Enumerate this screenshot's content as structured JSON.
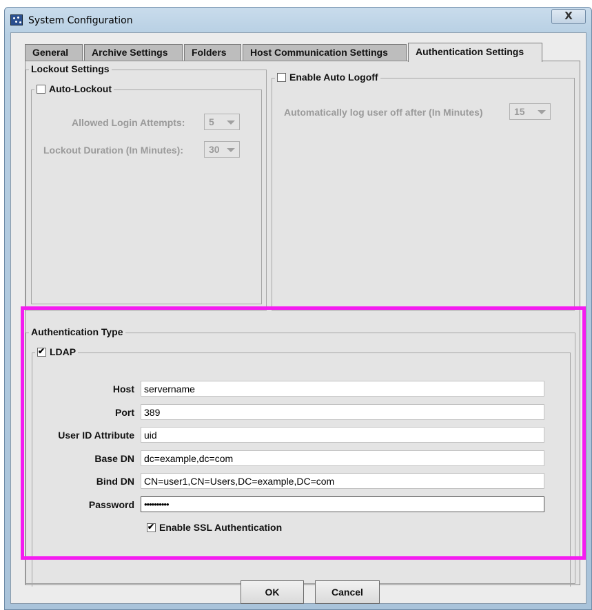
{
  "window": {
    "title": "System Configuration",
    "close_glyph": "X"
  },
  "tabs": [
    {
      "label": "General",
      "active": false
    },
    {
      "label": "Archive Settings",
      "active": false
    },
    {
      "label": "Folders",
      "active": false
    },
    {
      "label": "Host Communication Settings",
      "active": false
    },
    {
      "label": "Authentication Settings",
      "active": true
    }
  ],
  "lockout": {
    "group_title": "Lockout Settings",
    "auto_lockout_label": "Auto-Lockout",
    "auto_lockout_checked": false,
    "attempts_label": "Allowed Login Attempts:",
    "attempts_value": "5",
    "duration_label": "Lockout Duration (In Minutes):",
    "duration_value": "30"
  },
  "logoff": {
    "enable_label": "Enable Auto Logoff",
    "enable_checked": false,
    "after_label": "Automatically log user off after (In Minutes)",
    "after_value": "15"
  },
  "auth": {
    "group_title": "Authentication Type",
    "ldap_label": "LDAP",
    "ldap_checked": true,
    "fields": {
      "host_label": "Host",
      "host_value": "servername",
      "port_label": "Port",
      "port_value": "389",
      "uid_label": "User ID Attribute",
      "uid_value": "uid",
      "basedn_label": "Base DN",
      "basedn_value": "dc=example,dc=com",
      "binddn_label": "Bind DN",
      "binddn_value": "CN=user1,CN=Users,DC=example,DC=com",
      "password_label": "Password",
      "password_value": "••••••••••"
    },
    "ssl_label": "Enable SSL Authentication",
    "ssl_checked": true
  },
  "buttons": {
    "ok": "OK",
    "cancel": "Cancel"
  },
  "colors": {
    "highlight": "#f41cf0",
    "tab_active": "#e4e4e4",
    "tab_inactive": "#bdbdbd",
    "disabled_text": "#9a9a9a"
  },
  "icons": {
    "app": "app-logo-icon",
    "close": "close-icon",
    "dropdown": "chevron-down-icon",
    "check": "checkmark-icon"
  }
}
